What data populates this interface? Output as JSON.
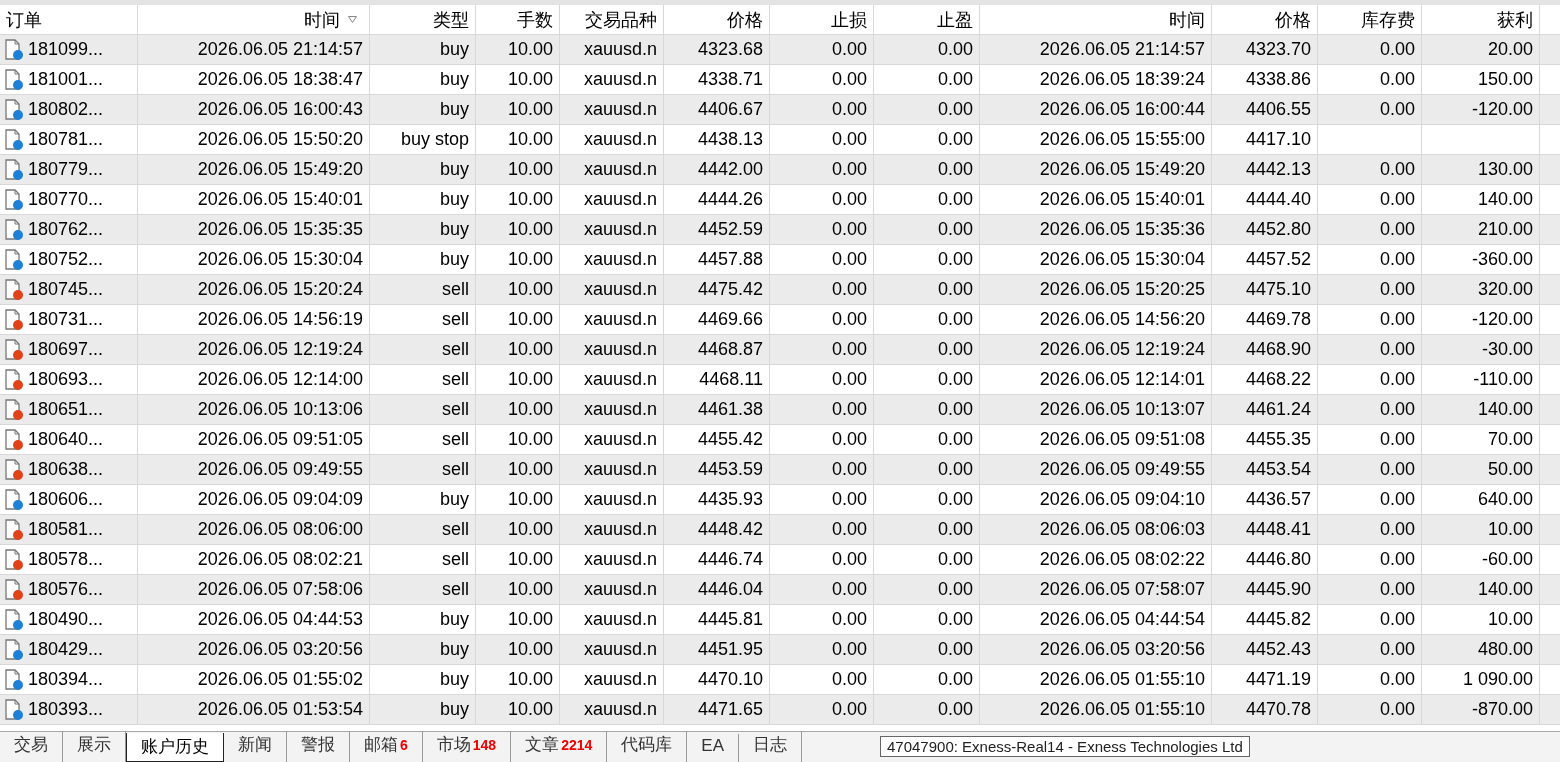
{
  "table": {
    "columns": [
      {
        "label": "订单",
        "sorted": false
      },
      {
        "label": "时间",
        "sorted": true
      },
      {
        "label": "类型",
        "sorted": false
      },
      {
        "label": "手数",
        "sorted": false
      },
      {
        "label": "交易品种",
        "sorted": false
      },
      {
        "label": "价格",
        "sorted": false
      },
      {
        "label": "止损",
        "sorted": false
      },
      {
        "label": "止盈",
        "sorted": false
      },
      {
        "label": "时间",
        "sorted": false
      },
      {
        "label": "价格",
        "sorted": false
      },
      {
        "label": "库存费",
        "sorted": false
      },
      {
        "label": "获利",
        "sorted": false
      }
    ],
    "rows": [
      {
        "color": "#1e7fd6",
        "cells": [
          "181099...",
          "2026.06.05 21:14:57",
          "buy",
          "10.00",
          "xauusd.n",
          "4323.68",
          "0.00",
          "0.00",
          "2026.06.05 21:14:57",
          "4323.70",
          "0.00",
          "20.00"
        ]
      },
      {
        "color": "#1e7fd6",
        "cells": [
          "181001...",
          "2026.06.05 18:38:47",
          "buy",
          "10.00",
          "xauusd.n",
          "4338.71",
          "0.00",
          "0.00",
          "2026.06.05 18:39:24",
          "4338.86",
          "0.00",
          "150.00"
        ]
      },
      {
        "color": "#1e7fd6",
        "cells": [
          "180802...",
          "2026.06.05 16:00:43",
          "buy",
          "10.00",
          "xauusd.n",
          "4406.67",
          "0.00",
          "0.00",
          "2026.06.05 16:00:44",
          "4406.55",
          "0.00",
          "-120.00"
        ]
      },
      {
        "color": "#1e7fd6",
        "cells": [
          "180781...",
          "2026.06.05 15:50:20",
          "buy stop",
          "10.00",
          "xauusd.n",
          "4438.13",
          "0.00",
          "0.00",
          "2026.06.05 15:55:00",
          "4417.10",
          null,
          null
        ]
      },
      {
        "color": "#1e7fd6",
        "cells": [
          "180779...",
          "2026.06.05 15:49:20",
          "buy",
          "10.00",
          "xauusd.n",
          "4442.00",
          "0.00",
          "0.00",
          "2026.06.05 15:49:20",
          "4442.13",
          "0.00",
          "130.00"
        ]
      },
      {
        "color": "#1e7fd6",
        "cells": [
          "180770...",
          "2026.06.05 15:40:01",
          "buy",
          "10.00",
          "xauusd.n",
          "4444.26",
          "0.00",
          "0.00",
          "2026.06.05 15:40:01",
          "4444.40",
          "0.00",
          "140.00"
        ]
      },
      {
        "color": "#1e7fd6",
        "cells": [
          "180762...",
          "2026.06.05 15:35:35",
          "buy",
          "10.00",
          "xauusd.n",
          "4452.59",
          "0.00",
          "0.00",
          "2026.06.05 15:35:36",
          "4452.80",
          "0.00",
          "210.00"
        ]
      },
      {
        "color": "#1e7fd6",
        "cells": [
          "180752...",
          "2026.06.05 15:30:04",
          "buy",
          "10.00",
          "xauusd.n",
          "4457.88",
          "0.00",
          "0.00",
          "2026.06.05 15:30:04",
          "4457.52",
          "0.00",
          "-360.00"
        ]
      },
      {
        "color": "#e0421a",
        "cells": [
          "180745...",
          "2026.06.05 15:20:24",
          "sell",
          "10.00",
          "xauusd.n",
          "4475.42",
          "0.00",
          "0.00",
          "2026.06.05 15:20:25",
          "4475.10",
          "0.00",
          "320.00"
        ]
      },
      {
        "color": "#e0421a",
        "cells": [
          "180731...",
          "2026.06.05 14:56:19",
          "sell",
          "10.00",
          "xauusd.n",
          "4469.66",
          "0.00",
          "0.00",
          "2026.06.05 14:56:20",
          "4469.78",
          "0.00",
          "-120.00"
        ]
      },
      {
        "color": "#e0421a",
        "cells": [
          "180697...",
          "2026.06.05 12:19:24",
          "sell",
          "10.00",
          "xauusd.n",
          "4468.87",
          "0.00",
          "0.00",
          "2026.06.05 12:19:24",
          "4468.90",
          "0.00",
          "-30.00"
        ]
      },
      {
        "color": "#e0421a",
        "cells": [
          "180693...",
          "2026.06.05 12:14:00",
          "sell",
          "10.00",
          "xauusd.n",
          "4468.11",
          "0.00",
          "0.00",
          "2026.06.05 12:14:01",
          "4468.22",
          "0.00",
          "-110.00"
        ]
      },
      {
        "color": "#e0421a",
        "cells": [
          "180651...",
          "2026.06.05 10:13:06",
          "sell",
          "10.00",
          "xauusd.n",
          "4461.38",
          "0.00",
          "0.00",
          "2026.06.05 10:13:07",
          "4461.24",
          "0.00",
          "140.00"
        ]
      },
      {
        "color": "#e0421a",
        "cells": [
          "180640...",
          "2026.06.05 09:51:05",
          "sell",
          "10.00",
          "xauusd.n",
          "4455.42",
          "0.00",
          "0.00",
          "2026.06.05 09:51:08",
          "4455.35",
          "0.00",
          "70.00"
        ]
      },
      {
        "color": "#e0421a",
        "cells": [
          "180638...",
          "2026.06.05 09:49:55",
          "sell",
          "10.00",
          "xauusd.n",
          "4453.59",
          "0.00",
          "0.00",
          "2026.06.05 09:49:55",
          "4453.54",
          "0.00",
          "50.00"
        ]
      },
      {
        "color": "#1e7fd6",
        "cells": [
          "180606...",
          "2026.06.05 09:04:09",
          "buy",
          "10.00",
          "xauusd.n",
          "4435.93",
          "0.00",
          "0.00",
          "2026.06.05 09:04:10",
          "4436.57",
          "0.00",
          "640.00"
        ]
      },
      {
        "color": "#e0421a",
        "cells": [
          "180581...",
          "2026.06.05 08:06:00",
          "sell",
          "10.00",
          "xauusd.n",
          "4448.42",
          "0.00",
          "0.00",
          "2026.06.05 08:06:03",
          "4448.41",
          "0.00",
          "10.00"
        ]
      },
      {
        "color": "#e0421a",
        "cells": [
          "180578...",
          "2026.06.05 08:02:21",
          "sell",
          "10.00",
          "xauusd.n",
          "4446.74",
          "0.00",
          "0.00",
          "2026.06.05 08:02:22",
          "4446.80",
          "0.00",
          "-60.00"
        ]
      },
      {
        "color": "#e0421a",
        "cells": [
          "180576...",
          "2026.06.05 07:58:06",
          "sell",
          "10.00",
          "xauusd.n",
          "4446.04",
          "0.00",
          "0.00",
          "2026.06.05 07:58:07",
          "4445.90",
          "0.00",
          "140.00"
        ]
      },
      {
        "color": "#1e7fd6",
        "cells": [
          "180490...",
          "2026.06.05 04:44:53",
          "buy",
          "10.00",
          "xauusd.n",
          "4445.81",
          "0.00",
          "0.00",
          "2026.06.05 04:44:54",
          "4445.82",
          "0.00",
          "10.00"
        ]
      },
      {
        "color": "#1e7fd6",
        "cells": [
          "180429...",
          "2026.06.05 03:20:56",
          "buy",
          "10.00",
          "xauusd.n",
          "4451.95",
          "0.00",
          "0.00",
          "2026.06.05 03:20:56",
          "4452.43",
          "0.00",
          "480.00"
        ]
      },
      {
        "color": "#1e7fd6",
        "cells": [
          "180394...",
          "2026.06.05 01:55:02",
          "buy",
          "10.00",
          "xauusd.n",
          "4470.10",
          "0.00",
          "0.00",
          "2026.06.05 01:55:10",
          "4471.19",
          "0.00",
          "1 090.00"
        ]
      },
      {
        "color": "#1e7fd6",
        "cells": [
          "180393...",
          "2026.06.05 01:53:54",
          "buy",
          "10.00",
          "xauusd.n",
          "4471.65",
          "0.00",
          "0.00",
          "2026.06.05 01:55:10",
          "4470.78",
          "0.00",
          "-870.00"
        ]
      }
    ]
  },
  "tabs": [
    {
      "label": "交易",
      "selected": false
    },
    {
      "label": "展示",
      "selected": false
    },
    {
      "label": "账户历史",
      "selected": true
    },
    {
      "label": "新闻",
      "selected": false
    },
    {
      "label": "警报",
      "selected": false
    },
    {
      "label": "邮箱",
      "selected": false,
      "badge": "6"
    },
    {
      "label": "市场",
      "selected": false,
      "badge": "148"
    },
    {
      "label": "文章",
      "selected": false,
      "badge": "2214"
    },
    {
      "label": "代码库",
      "selected": false
    },
    {
      "label": "EA",
      "selected": false
    },
    {
      "label": "日志",
      "selected": false
    }
  ],
  "tooltip": {
    "text": "47047900: Exness-Real14 - Exness Technologies Ltd"
  }
}
